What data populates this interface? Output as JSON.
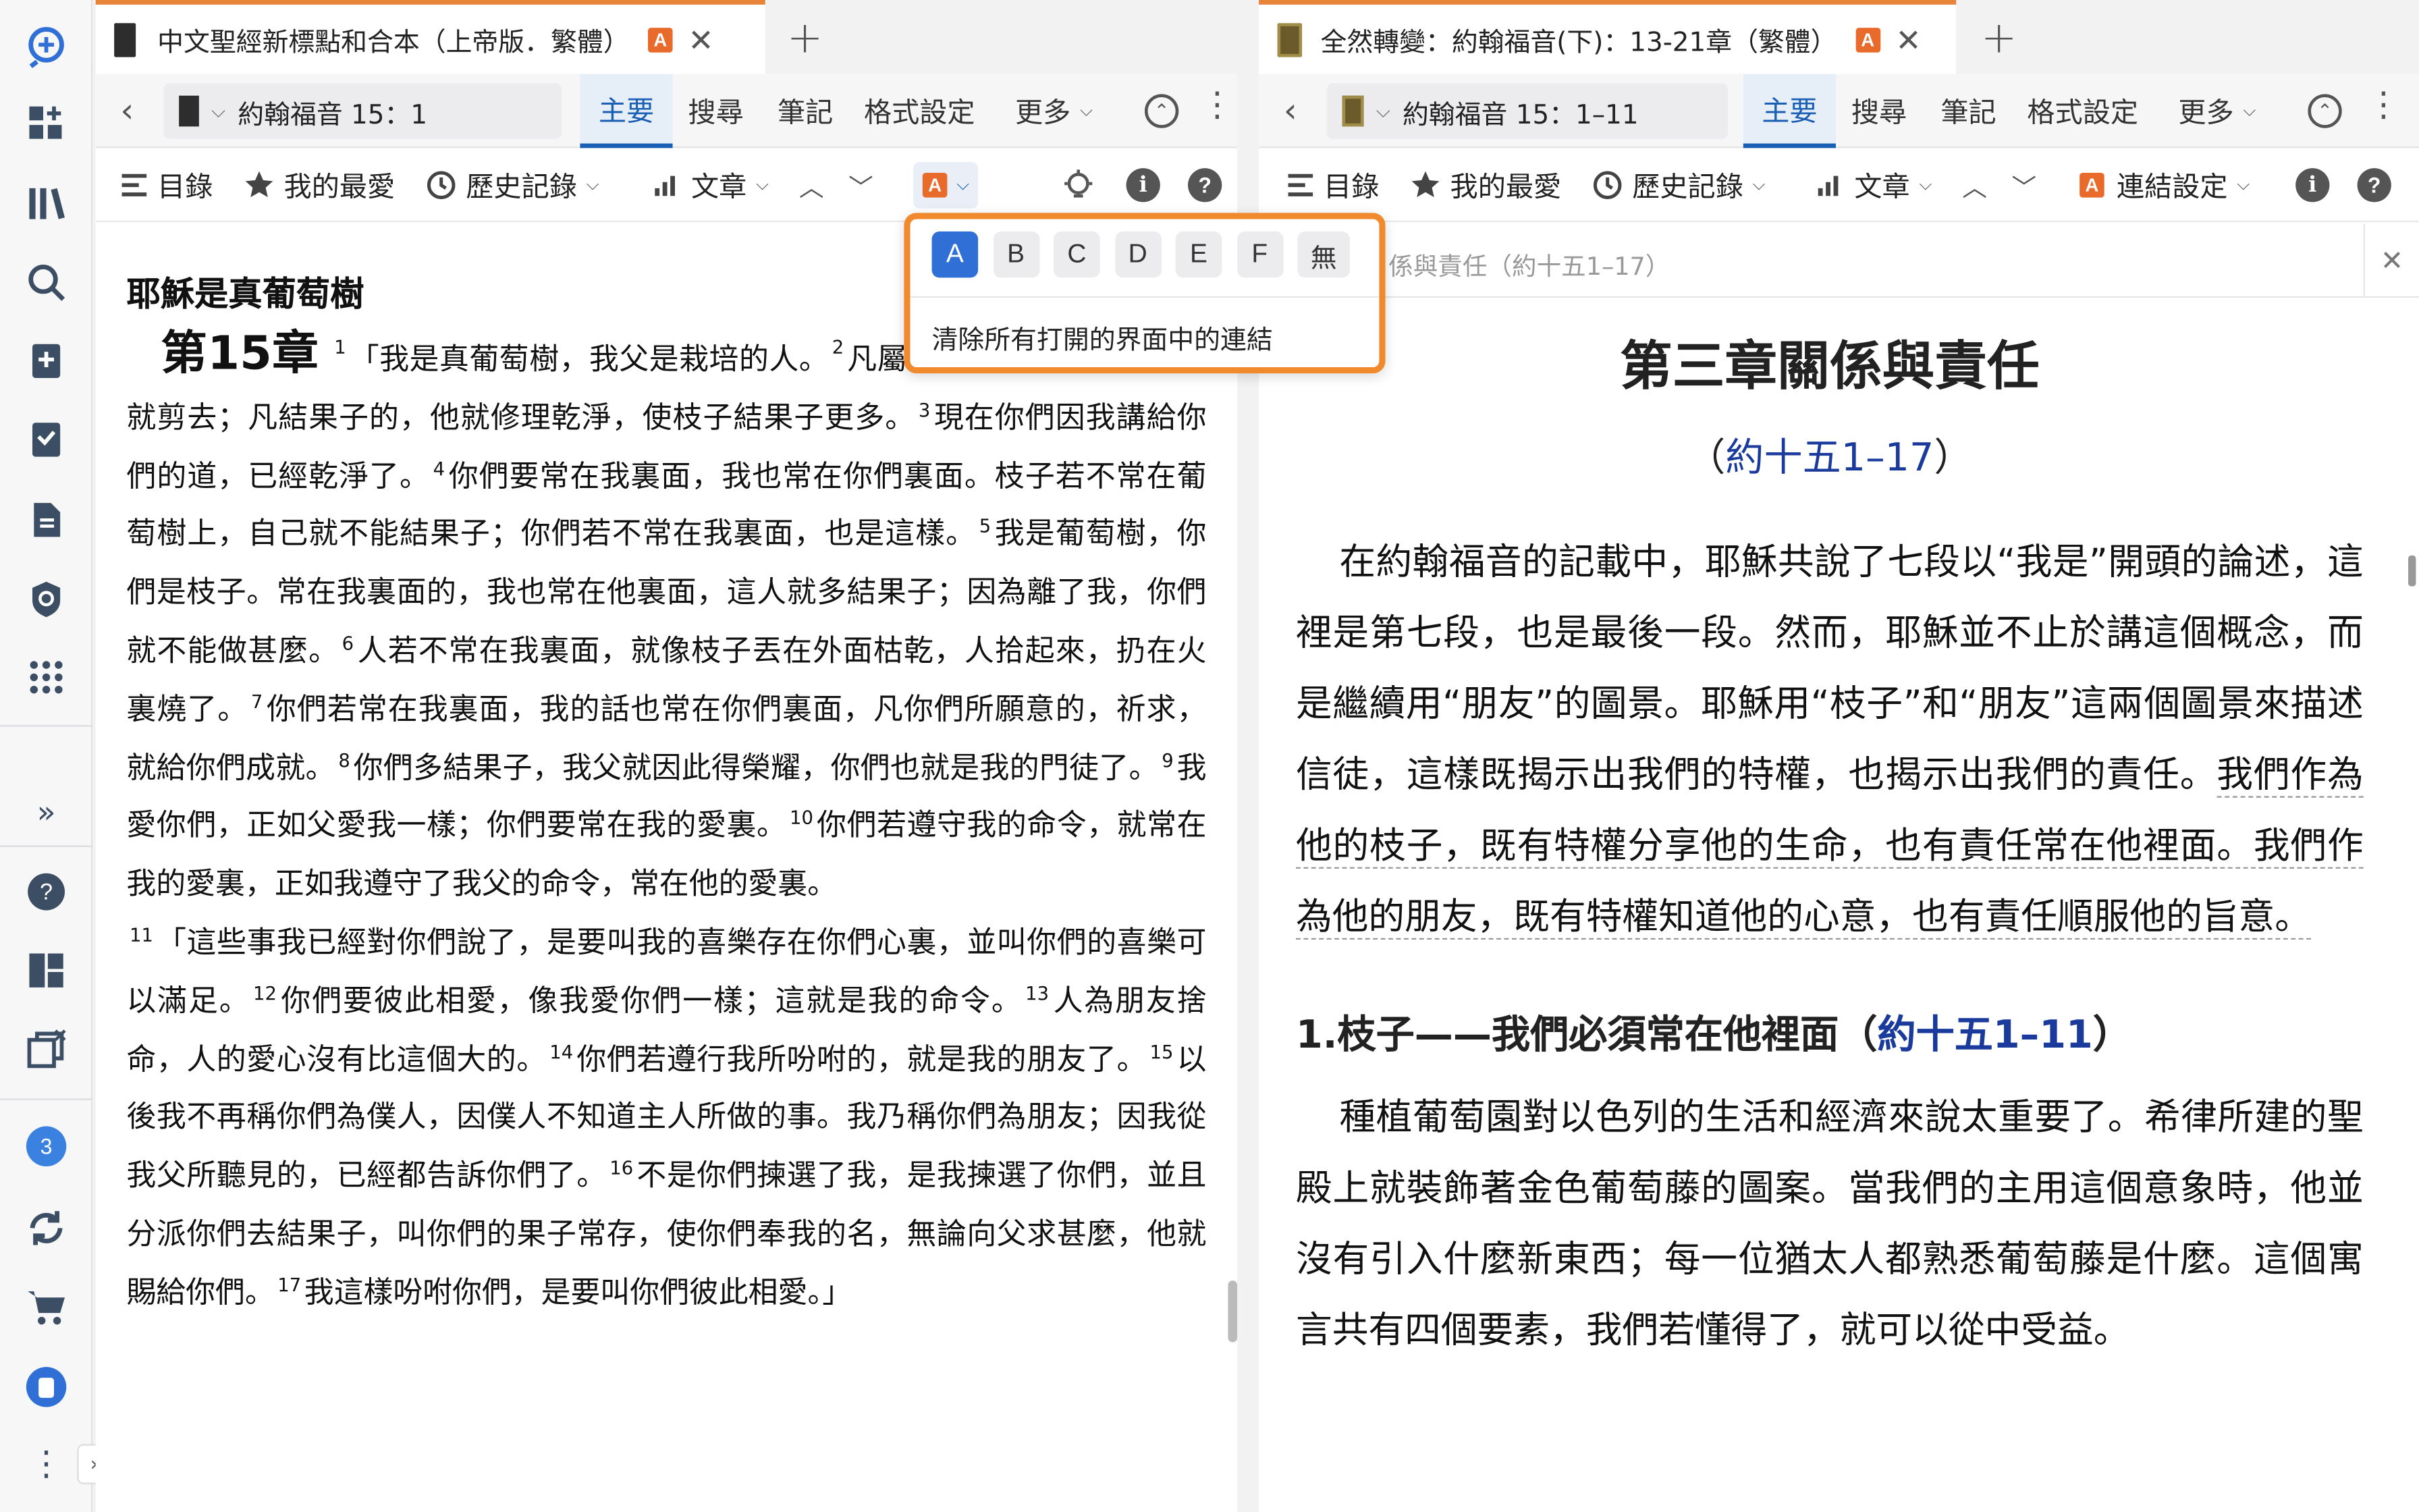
{
  "appbar": {
    "badge_count": "3"
  },
  "left": {
    "tab_title": "中文聖經新標點和合本（上帝版．繁體）",
    "tab_tag": "A",
    "ref": "約翰福音 15：1",
    "nav": [
      "主要",
      "搜尋",
      "筆記",
      "格式設定",
      "更多"
    ],
    "toolbar": {
      "toc": "目錄",
      "favorites": "我的最愛",
      "history": "歷史記錄",
      "article": "文章",
      "link_tag": "A"
    },
    "heading": "耶穌是真葡萄樹",
    "chapter": "第15章",
    "para1": [
      {
        "n": "1",
        "t": "「我是真葡萄樹，我父是栽培的人。"
      },
      {
        "n": "2",
        "t": "凡屬我不結果子的枝子，他就剪去；凡結果子的，他就修理乾淨，使枝子結果子更多。"
      },
      {
        "n": "3",
        "t": "現在你們因我講給你們的道，已經乾淨了。"
      },
      {
        "n": "4",
        "t": "你們要常在我裏面，我也常在你們裏面。枝子若不常在葡萄樹上，自己就不能結果子；你們若不常在我裏面，也是這樣。"
      },
      {
        "n": "5",
        "t": "我是葡萄樹，你們是枝子。常在我裏面的，我也常在他裏面，這人就多結果子；因為離了我，你們就不能做甚麼。"
      },
      {
        "n": "6",
        "t": "人若不常在我裏面，就像枝子丟在外面枯乾，人拾起來，扔在火裏燒了。"
      },
      {
        "n": "7",
        "t": "你們若常在我裏面，我的話也常在你們裏面，凡你們所願意的，祈求，就給你們成就。"
      },
      {
        "n": "8",
        "t": "你們多結果子，我父就因此得榮耀，你們也就是我的門徒了。"
      },
      {
        "n": "9",
        "t": "我愛你們，正如父愛我一樣；你們要常在我的愛裏。"
      },
      {
        "n": "10",
        "t": "你們若遵守我的命令，就常在我的愛裏，正如我遵守了我父的命令，常在他的愛裏。"
      }
    ],
    "para2": [
      {
        "n": "11",
        "t": "「這些事我已經對你們說了，是要叫我的喜樂存在你們心裏，並叫你們的喜樂可以滿足。"
      },
      {
        "n": "12",
        "t": "你們要彼此相愛，像我愛你們一樣；這就是我的命令。"
      },
      {
        "n": "13",
        "t": "人為朋友捨命，人的愛心沒有比這個大的。"
      },
      {
        "n": "14",
        "t": "你們若遵行我所吩咐的，就是我的朋友了。"
      },
      {
        "n": "15",
        "t": "以後我不再稱你們為僕人，因僕人不知道主人所做的事。我乃稱你們為朋友；因我從我父所聽見的，已經都告訴你們了。"
      },
      {
        "n": "16",
        "t": "不是你們揀選了我，是我揀選了你們，並且分派你們去結果子，叫你們的果子常存，使你們奉我的名，無論向父求甚麼，他就賜給你們。"
      },
      {
        "n": "17",
        "t": "我這樣吩咐你們，是要叫你們彼此相愛。」"
      }
    ]
  },
  "dropdown": {
    "options": [
      "A",
      "B",
      "C",
      "D",
      "E",
      "F",
      "無"
    ],
    "selected": "A",
    "clear_label": "清除所有打開的界面中的連結"
  },
  "right": {
    "tab_title": "全然轉變：約翰福音(下)：13-21章（繁體）",
    "tab_tag": "A",
    "ref": "約翰福音 15：1–11",
    "nav": [
      "主要",
      "搜尋",
      "筆記",
      "格式設定",
      "更多"
    ],
    "toolbar": {
      "toc": "目錄",
      "favorites": "我的最愛",
      "history": "歷史記錄",
      "article": "文章",
      "link_settings": "連結設定",
      "link_tag": "A"
    },
    "breadcrumb": "係與責任（約十五1–17）",
    "chapter_title": "第三章關係與責任",
    "chapter_ref_open": "（",
    "chapter_ref": "約十五1–17",
    "chapter_ref_close": "）",
    "p1a": "在約翰福音的記載中，耶穌共說了七段以“我是”開頭的論述，這裡是第七段，也是最後一段。然而，耶穌並不止於講這個概念，而是繼續用“朋友”的圖景。耶穌用“枝子”和“朋友”這兩個圖景來描述信徒，這樣既揭示出我們的特權，也揭示出我們的責任。",
    "p1b": "我們作為他的枝子，既有特權分享他的生命，也有責任常在他裡面。我們作為他的朋友，既有特權知道他的心意，也有責任順服他的旨意。",
    "h2": "1.枝子——我們必須常在他裡面（",
    "h2_ref": "約十五1–11",
    "h2_close": "）",
    "p2": "種植葡萄園對以色列的生活和經濟來說太重要了。希律所建的聖殿上就裝飾著金色葡萄藤的圖案。當我們的主用這個意象時，他並沒有引入什麼新東西；每一位猶太人都熟悉葡萄藤是什麼。這個寓言共有四個要素，我們若懂得了，就可以從中受益。"
  }
}
